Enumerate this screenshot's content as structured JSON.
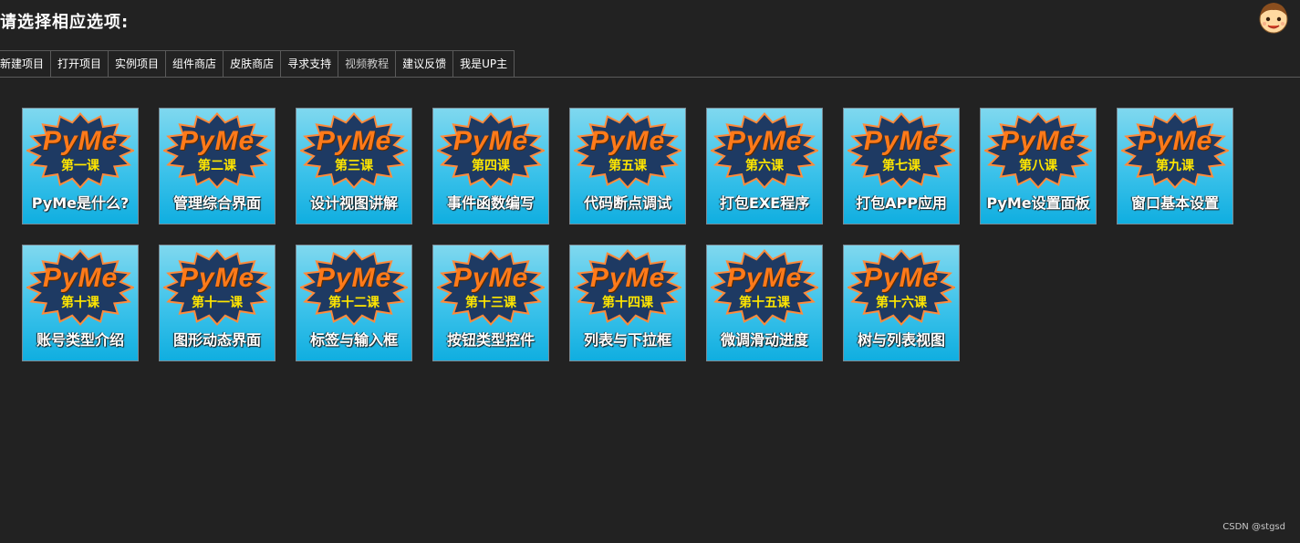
{
  "header": {
    "title": "请选择相应选项:"
  },
  "avatar": {
    "icon": "cartoon-boy-avatar"
  },
  "tabs": [
    {
      "label": "新建项目"
    },
    {
      "label": "打开项目"
    },
    {
      "label": "实例项目"
    },
    {
      "label": "组件商店"
    },
    {
      "label": "皮肤商店"
    },
    {
      "label": "寻求支持"
    },
    {
      "label": "视频教程",
      "active": true
    },
    {
      "label": "建议反馈"
    },
    {
      "label": "我是UP主"
    }
  ],
  "brand": "PyMe",
  "lessons": [
    {
      "lesson": "第一课",
      "caption": "PyMe是什么?"
    },
    {
      "lesson": "第二课",
      "caption": "管理综合界面"
    },
    {
      "lesson": "第三课",
      "caption": "设计视图讲解"
    },
    {
      "lesson": "第四课",
      "caption": "事件函数编写"
    },
    {
      "lesson": "第五课",
      "caption": "代码断点调试"
    },
    {
      "lesson": "第六课",
      "caption": "打包EXE程序"
    },
    {
      "lesson": "第七课",
      "caption": "打包APP应用"
    },
    {
      "lesson": "第八课",
      "caption": "PyMe设置面板"
    },
    {
      "lesson": "第九课",
      "caption": "窗口基本设置"
    },
    {
      "lesson": "第十课",
      "caption": "账号类型介绍"
    },
    {
      "lesson": "第十一课",
      "caption": "图形动态界面"
    },
    {
      "lesson": "第十二课",
      "caption": "标签与输入框"
    },
    {
      "lesson": "第十三课",
      "caption": "按钮类型控件"
    },
    {
      "lesson": "第十四课",
      "caption": "列表与下拉框"
    },
    {
      "lesson": "第十五课",
      "caption": "微调滑动进度"
    },
    {
      "lesson": "第十六课",
      "caption": "树与列表视图"
    }
  ],
  "colors": {
    "background": "#222222",
    "tile_top": "#7fd8ef",
    "tile_bottom": "#10aee0",
    "burst": "#1e3a63",
    "brand": "#ff7a1a",
    "lesson_text": "#ffe600"
  },
  "watermark": "CSDN @stgsd"
}
